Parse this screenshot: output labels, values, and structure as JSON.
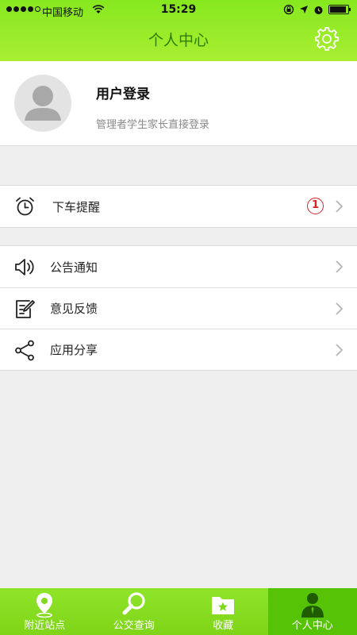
{
  "status_bar": {
    "carrier": "中国移动",
    "time": "15:29"
  },
  "header": {
    "title": "个人中心"
  },
  "profile": {
    "title": "用户登录",
    "subtitle": "管理者学生家长直接登录"
  },
  "menu": {
    "alarm": {
      "label": "下车提醒",
      "badge": "1"
    },
    "items": [
      {
        "label": "公告通知",
        "icon": "speaker-icon"
      },
      {
        "label": "意见反馈",
        "icon": "edit-icon"
      },
      {
        "label": "应用分享",
        "icon": "share-icon"
      }
    ]
  },
  "tabs": [
    {
      "label": "附近站点",
      "icon": "location-pin-icon"
    },
    {
      "label": "公交查询",
      "icon": "search-icon"
    },
    {
      "label": "收藏",
      "icon": "folder-star-icon"
    },
    {
      "label": "个人中心",
      "icon": "person-icon"
    }
  ],
  "colors": {
    "accent_green": "#86e81f",
    "title_green": "#2f7d00",
    "badge_red": "#e02020",
    "active_tab": "#57c306"
  }
}
